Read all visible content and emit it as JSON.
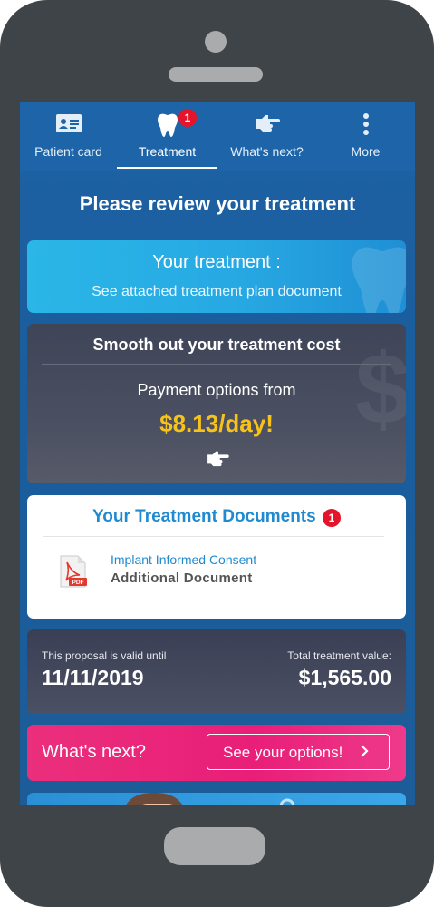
{
  "nav": {
    "tabs": [
      {
        "label": "Patient card",
        "icon": "id-card-icon"
      },
      {
        "label": "Treatment",
        "icon": "tooth-icon",
        "badge": "1",
        "active": true
      },
      {
        "label": "What's next?",
        "icon": "pointing-hand-icon"
      },
      {
        "label": "More",
        "icon": "more-dots-icon"
      }
    ]
  },
  "page": {
    "title": "Please review your treatment"
  },
  "treatment_card": {
    "title": "Your treatment :",
    "subtitle": "See attached treatment plan document"
  },
  "cost_card": {
    "title": "Smooth out your treatment cost",
    "payment_label": "Payment options from",
    "price": "$8.13/day!"
  },
  "documents_card": {
    "title": "Your Treatment Documents",
    "badge": "1",
    "items": [
      {
        "name": "Implant Informed Consent",
        "type": "Additional Document",
        "icon": "pdf-file-icon",
        "icon_text": "PDF"
      }
    ]
  },
  "validity_card": {
    "valid_label": "This proposal is valid until",
    "valid_date": "11/11/2019",
    "total_label": "Total treatment value:",
    "total_value": "$1,565.00"
  },
  "next_card": {
    "title": "What's next?",
    "button_label": "See your options!"
  },
  "colors": {
    "header_blue": "#1d64a8",
    "accent_cyan": "#27a9e3",
    "price_yellow": "#f7c21a",
    "link_blue": "#1f8ad0",
    "cta_pink": "#e91e78",
    "badge_red": "#e4142a"
  }
}
